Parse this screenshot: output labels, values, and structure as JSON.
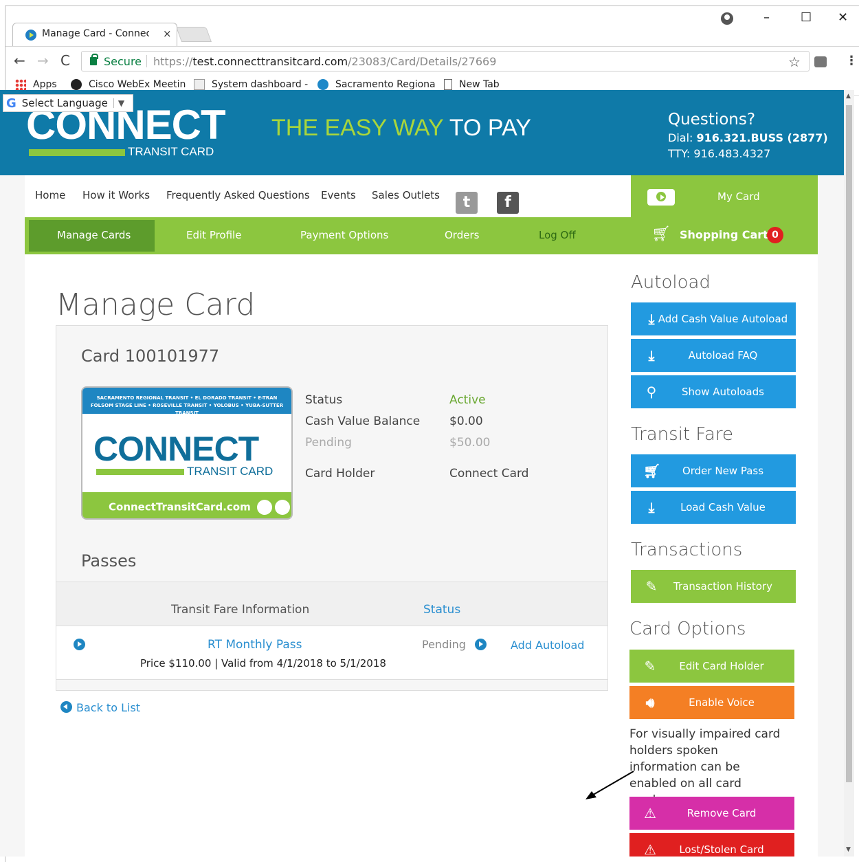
{
  "browser": {
    "tab_title": "Manage Card - Connect (",
    "tab_close": "×",
    "secure_label": "Secure",
    "url_scheme": "https://",
    "url_host": "test.connecttransitcard.com",
    "url_path": "/23083/Card/Details/27669",
    "win_minimize": "–",
    "win_maximize": "☐",
    "win_close": "✕",
    "back": "←",
    "forward": "→",
    "reload": "C",
    "star": "☆",
    "menu": "⋮",
    "bookmarks": [
      {
        "label": "Apps",
        "icon": "apps-icon"
      },
      {
        "label": "Cisco WebEx Meetin",
        "icon": "webex-icon"
      },
      {
        "label": "System dashboard -",
        "icon": "system-dashboard-icon"
      },
      {
        "label": "Sacramento Regiona",
        "icon": "sacramento-icon"
      },
      {
        "label": "New Tab",
        "icon": "page-icon"
      }
    ]
  },
  "header": {
    "language_select": "Select Language",
    "language_arrow": "▼",
    "google_g": "G",
    "logo_text": "CONNECT",
    "logo_sub": "TRANSIT CARD",
    "tagline_green": "THE EASY WAY",
    "tagline_white": " TO PAY",
    "questions_title": "Questions?",
    "dial_label": "Dial: ",
    "dial_number": "916.321.BUSS (2877)",
    "tty": "TTY: 916.483.4327"
  },
  "topnav": {
    "items": [
      "Home",
      "How it Works",
      "Frequently Asked Questions",
      "Events",
      "Sales Outlets"
    ],
    "twitter": "t",
    "facebook": "f",
    "my_card": "My Card"
  },
  "subnav": {
    "items": [
      "Manage Cards",
      "Edit Profile",
      "Payment Options",
      "Orders",
      "Log Off"
    ],
    "cart_label": "Shopping Cart",
    "cart_count": "0"
  },
  "main": {
    "title": "Manage Card",
    "card_heading": "Card 100101977",
    "card_image": {
      "top_line1": "SACRAMENTO REGIONAL TRANSIT • EL DORADO TRANSIT • E-TRAN",
      "top_line2": "FOLSOM STAGE LINE • ROSEVILLE TRANSIT • YOLOBUS • YUBA-SUTTER TRANSIT",
      "logo": "CONNECT",
      "sub": "TRANSIT CARD",
      "website": "ConnectTransitCard.com"
    },
    "details": {
      "status_label": "Status",
      "status_value": "Active",
      "balance_label": "Cash Value Balance",
      "balance_value": "$0.00",
      "pending_label": "Pending",
      "pending_value": "$50.00",
      "holder_label": "Card Holder",
      "holder_value": "Connect Card"
    },
    "passes_heading": "Passes",
    "table_headers": {
      "info": "Transit Fare Information",
      "status": "Status"
    },
    "passes": [
      {
        "name": "RT Monthly Pass",
        "detail": "Price $110.00 | Valid from 4/1/2018 to 5/1/2018",
        "status": "Pending",
        "action": "Add Autoload"
      }
    ],
    "back_link": "Back to List"
  },
  "sidebar": {
    "autoload_heading": "Autoload",
    "add_cash_value_autoload": "Add Cash Value Autoload",
    "autoload_faq": "Autoload FAQ",
    "show_autoloads": "Show Autoloads",
    "transit_fare_heading": "Transit Fare",
    "order_new_pass": "Order New Pass",
    "load_cash_value": "Load Cash Value",
    "transactions_heading": "Transactions",
    "transaction_history": "Transaction History",
    "card_options_heading": "Card Options",
    "edit_card_holder": "Edit Card Holder",
    "enable_voice": "Enable Voice",
    "voice_note": "For visually impaired card holders spoken information can be enabled on all card readers.",
    "remove_card": "Remove Card",
    "lost_stolen_card": "Lost/Stolen Card"
  },
  "colors": {
    "header_blue": "#0f7aa8",
    "nav_green": "#8cc63f",
    "active_green": "#5d9c2c",
    "button_blue": "#229ae0",
    "orange": "#f47f24",
    "magenta": "#d62fa8",
    "red": "#e02020"
  }
}
